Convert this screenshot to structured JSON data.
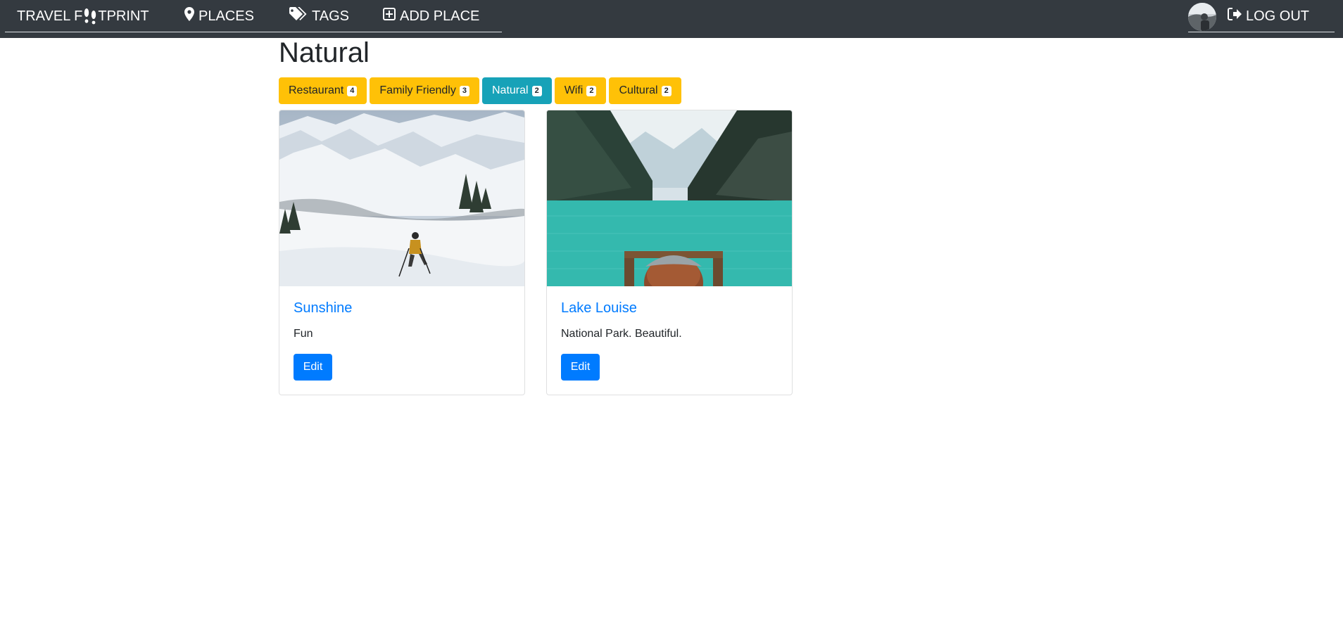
{
  "nav": {
    "brand_prefix": "TRAVEL F",
    "brand_suffix": "TPRINT",
    "places": "PLACES",
    "tags": "TAGS",
    "add_place": "ADD PLACE",
    "logout": "LOG OUT",
    "icons": {
      "brand": "footprints-icon",
      "places": "map-marker-icon",
      "tags": "tags-icon",
      "add_place": "plus-square-icon",
      "logout": "sign-out-icon"
    }
  },
  "page": {
    "title": "Natural"
  },
  "tags": [
    {
      "label": "Restaurant",
      "count": "4",
      "active": false
    },
    {
      "label": "Family Friendly",
      "count": "3",
      "active": false
    },
    {
      "label": "Natural",
      "count": "2",
      "active": true
    },
    {
      "label": "Wifi",
      "count": "2",
      "active": false
    },
    {
      "label": "Cultural",
      "count": "2",
      "active": false
    }
  ],
  "places": [
    {
      "title": "Sunshine",
      "description": "Fun",
      "edit_label": "Edit",
      "image": "snowy-mountain-skier-photo"
    },
    {
      "title": "Lake Louise",
      "description": "National Park. Beautiful.",
      "edit_label": "Edit",
      "image": "turquoise-lake-mountains-photo"
    }
  ],
  "colors": {
    "navbar": "#343a40",
    "tag_warning": "#ffc107",
    "tag_active": "#17a2b8",
    "primary": "#007bff"
  }
}
